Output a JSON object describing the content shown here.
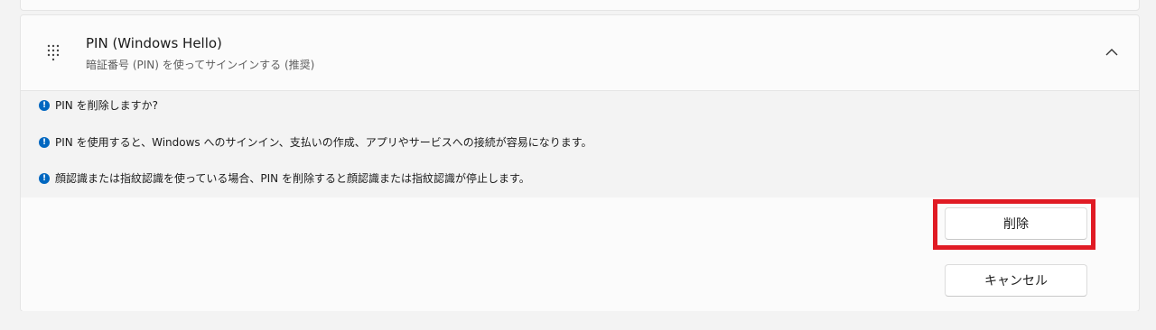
{
  "pin_section": {
    "title": "PIN (Windows Hello)",
    "subtitle": "暗証番号 (PIN) を使ってサインインする (推奨)",
    "icon": "keypad-icon",
    "expand_icon": "chevron-up-icon"
  },
  "info_messages": [
    "PIN を削除しますか?",
    "PIN を使用すると、Windows へのサインイン、支払いの作成、アプリやサービスへの接続が容易になります。",
    "顔認識または指紋認識を使っている場合、PIN を削除すると顔認識または指紋認識が停止します。"
  ],
  "info_icon": "!",
  "actions": {
    "delete_label": "削除",
    "cancel_label": "キャンセル"
  },
  "colors": {
    "accent": "#0067c0",
    "highlight": "#e01b24"
  }
}
